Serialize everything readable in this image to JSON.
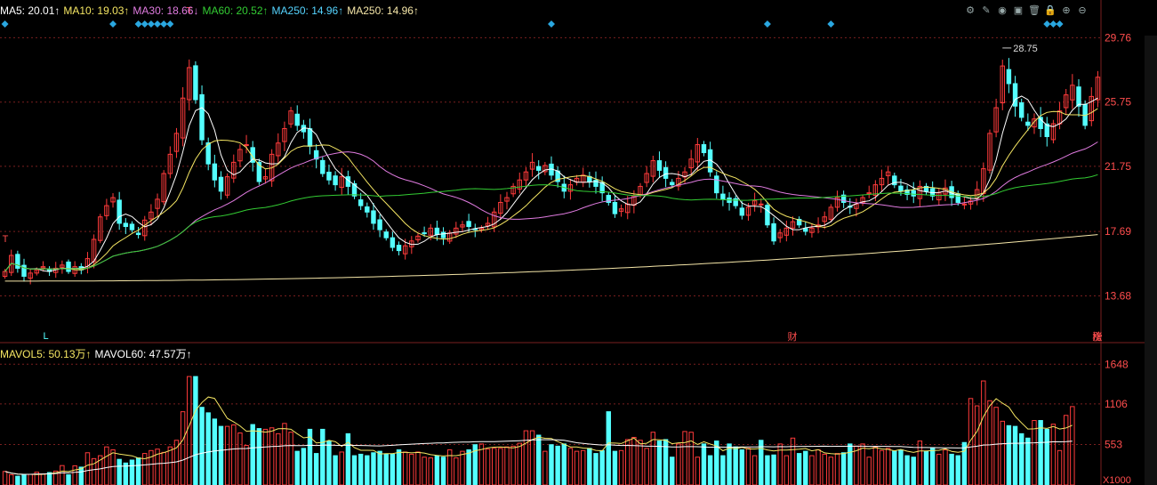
{
  "top_legend": [
    {
      "label": "MA5: 20.01",
      "arrow": "↑",
      "color": "#ffffff"
    },
    {
      "label": "MA10: 19.03",
      "arrow": "↑",
      "color": "#f5e663"
    },
    {
      "label": "MA30: 18.66",
      "arrow": "↓",
      "color": "#e07be0"
    },
    {
      "label": "MA60: 20.52",
      "arrow": "↑",
      "color": "#33cc33"
    },
    {
      "label": "MA250: 14.96",
      "arrow": "↑",
      "color": "#55d4ff"
    },
    {
      "label": "MA250: 14.96",
      "arrow": "↑",
      "color": "#f5e6a8"
    }
  ],
  "vol_legend": [
    {
      "label": "MAVOL5: 50.13万",
      "arrow": "↑",
      "color": "#f5e663"
    },
    {
      "label": "MAVOL60: 47.57万",
      "arrow": "↑",
      "color": "#ffffff"
    }
  ],
  "toolbar_icons": [
    "settings-icon",
    "pen-icon",
    "eye-icon",
    "briefcase-icon",
    "trash-icon",
    "lock-icon",
    "zoom-in-icon",
    "zoom-out-icon"
  ],
  "chart_data": [
    {
      "type": "candlestick",
      "y_ticks": [
        "29.76",
        "25.75",
        "21.75",
        "17.69",
        "13.68"
      ],
      "ylim": [
        11.6,
        31.0
      ],
      "max_label": "28.75",
      "event_markers": [
        "财",
        "榜",
        "涨"
      ],
      "low_marker": "L",
      "high_marker": "T",
      "colors": {
        "up": "#ff3b3b",
        "down": "#54ffff",
        "ma5": "#ffffff",
        "ma10": "#f5e663",
        "ma30": "#e07be0",
        "ma60": "#33cc33",
        "ma250": "#f5e6a8",
        "grid": "#7a1f1f"
      },
      "close": [
        15.2,
        16.2,
        15.4,
        14.9,
        15.1,
        15.3,
        15.5,
        15.2,
        15.4,
        15.6,
        15.2,
        15.5,
        15.3,
        16.0,
        17.2,
        18.6,
        19.3,
        19.8,
        18.2,
        18.0,
        17.8,
        17.5,
        18.4,
        18.9,
        19.7,
        21.3,
        22.5,
        23.8,
        26.0,
        27.9,
        25.9,
        23.4,
        21.9,
        20.9,
        20.2,
        21.1,
        22.0,
        22.8,
        23.1,
        22.0,
        20.8,
        21.1,
        22.5,
        23.2,
        24.1,
        25.2,
        24.3,
        23.9,
        23.0,
        22.2,
        21.3,
        20.9,
        20.6,
        21.1,
        20.5,
        19.9,
        19.3,
        18.9,
        18.2,
        17.8,
        17.3,
        16.7,
        16.5,
        16.8,
        17.1,
        17.4,
        17.6,
        17.9,
        17.5,
        17.3,
        17.6,
        17.9,
        18.1,
        18.0,
        17.8,
        17.9,
        18.2,
        18.9,
        19.5,
        19.8,
        20.5,
        20.9,
        21.4,
        22.0,
        21.5,
        21.8,
        21.2,
        20.8,
        20.2,
        20.6,
        21.0,
        21.2,
        20.8,
        20.5,
        20.1,
        19.5,
        18.8,
        19.1,
        19.4,
        19.9,
        20.5,
        21.3,
        22.1,
        21.5,
        21.0,
        20.6,
        21.0,
        21.4,
        22.2,
        23.1,
        22.6,
        21.4,
        20.1,
        19.7,
        19.5,
        19.3,
        18.7,
        19.2,
        19.6,
        19.4,
        18.1,
        17.1,
        17.6,
        17.9,
        18.3,
        18.1,
        17.7,
        17.9,
        18.1,
        18.6,
        19.2,
        19.8,
        19.5,
        19.2,
        19.4,
        19.8,
        20.1,
        20.6,
        21.0,
        21.4,
        20.6,
        20.2,
        20.0,
        19.9,
        20.5,
        20.2,
        19.9,
        20.1,
        20.4,
        19.8,
        19.5,
        19.4,
        19.6,
        20.3,
        21.6,
        23.8,
        25.4,
        28.0,
        26.9,
        25.5,
        24.8,
        24.3,
        24.7,
        24.1,
        23.6,
        24.4,
        25.2,
        26.2,
        26.8,
        25.5,
        24.3,
        26.1,
        27.3
      ],
      "volume": [
        185,
        140,
        120,
        138,
        145,
        175,
        150,
        170,
        190,
        265,
        140,
        262,
        244,
        440,
        360,
        400,
        520,
        480,
        350,
        300,
        340,
        370,
        430,
        470,
        490,
        445,
        520,
        610,
        1000,
        1480,
        1480,
        1060,
        985,
        900,
        800,
        800,
        820,
        710,
        540,
        825,
        770,
        760,
        780,
        700,
        840,
        720,
        460,
        500,
        760,
        430,
        760,
        600,
        400,
        450,
        700,
        400,
        420,
        400,
        440,
        460,
        420,
        420,
        480,
        450,
        420,
        450,
        380,
        370,
        400,
        380,
        480,
        370,
        460,
        480,
        550,
        560,
        490,
        500,
        500,
        520,
        530,
        570,
        740,
        740,
        680,
        460,
        550,
        530,
        560,
        500,
        460,
        470,
        500,
        430,
        470,
        1000,
        460,
        470,
        620,
        650,
        610,
        500,
        720,
        600,
        620,
        380,
        560,
        730,
        720,
        380,
        560,
        400,
        600,
        400,
        560,
        520,
        480,
        500,
        400,
        610,
        400,
        410,
        560,
        400,
        640,
        430,
        460,
        400,
        480,
        420,
        380,
        430,
        440,
        560,
        530,
        560,
        380,
        520,
        470,
        500,
        460,
        480,
        400,
        380,
        600,
        460,
        510,
        420,
        480,
        420,
        400,
        580,
        1180,
        1080,
        1420,
        1150,
        1060,
        870,
        810,
        800,
        700,
        640,
        880,
        880,
        760,
        830,
        470,
        950,
        1070
      ]
    }
  ]
}
